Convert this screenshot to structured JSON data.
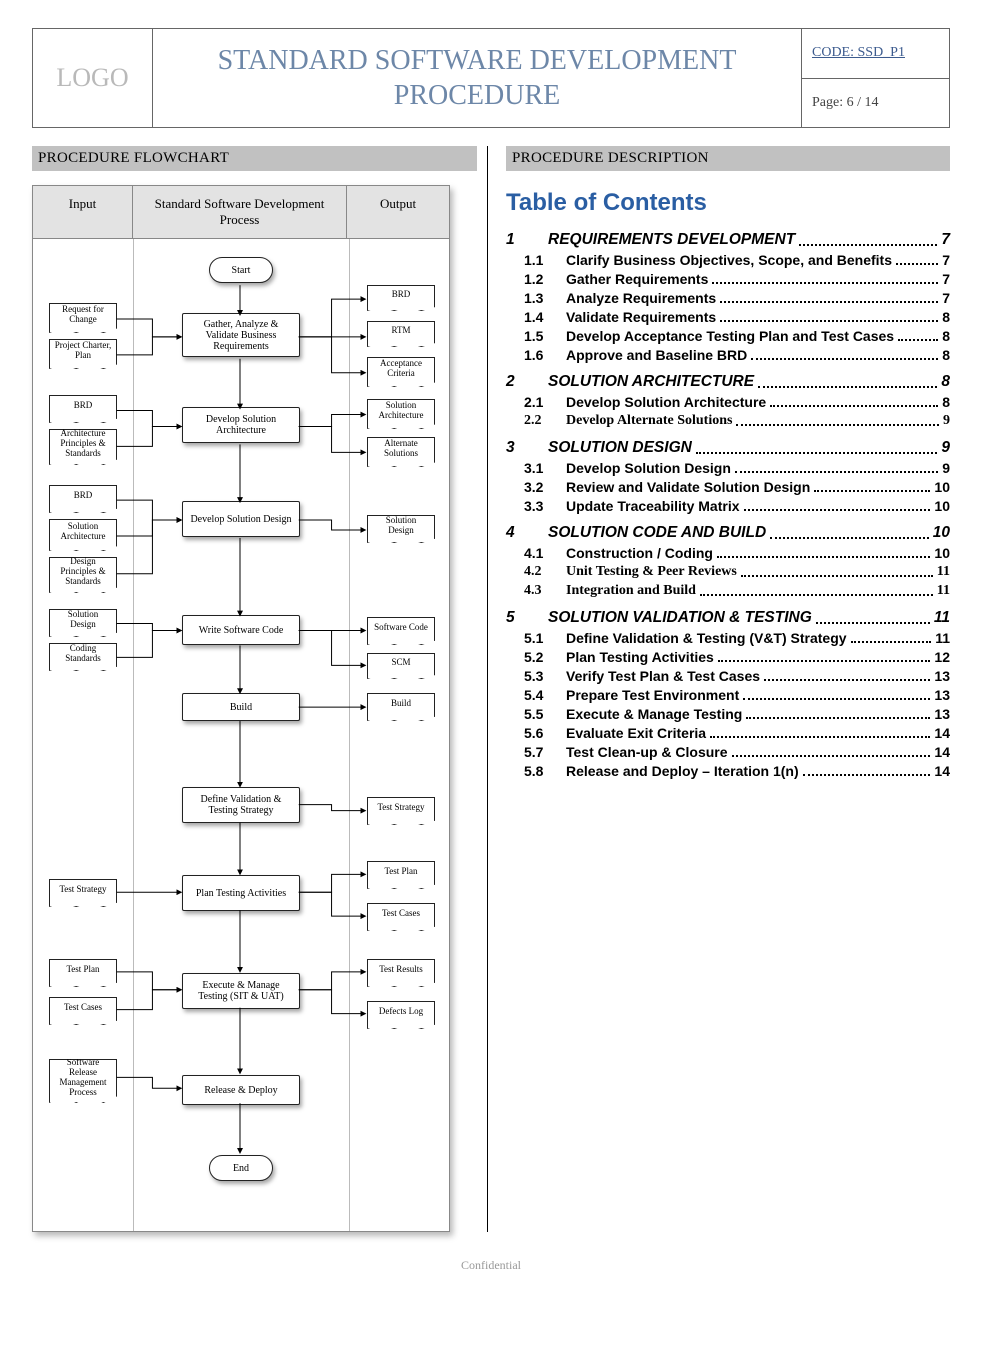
{
  "header": {
    "logo": "LOGO",
    "title": "STANDARD SOFTWARE DEVELOPMENT PROCEDURE",
    "code_label": "CODE:",
    "code_value": "SSD_P1",
    "page_label": "Page: 6 / 14"
  },
  "sections": {
    "flow": "PROCEDURE FLOWCHART",
    "desc": "PROCEDURE DESCRIPTION"
  },
  "flow": {
    "head_input": "Input",
    "head_process": "Standard Software Development Process",
    "head_output": "Output",
    "start": "Start",
    "end": "End",
    "procs": {
      "p1": "Gather, Analyze & Validate Business Requirements",
      "p2": "Develop Solution Architecture",
      "p3": "Develop Solution Design",
      "p4": "Write Software Code",
      "p5": "Build",
      "p6": "Define Validation & Testing Strategy",
      "p7": "Plan Testing Activities",
      "p8": "Execute & Manage Testing (SIT & UAT)",
      "p9": "Release & Deploy"
    },
    "inputs": {
      "i1": "Request for Change",
      "i2": "Project Charter, Plan",
      "i3": "BRD",
      "i4": "Architecture Principles & Standards",
      "i5": "BRD",
      "i6": "Solution Architecture",
      "i7": "Design Principles & Standards",
      "i8": "Solution Design",
      "i9": "Coding Standards",
      "i10": "Test Strategy",
      "i11": "Test Plan",
      "i12": "Test Cases",
      "i13": "Software Release Management Process"
    },
    "outputs": {
      "o1": "BRD",
      "o2": "RTM",
      "o3": "Acceptance Criteria",
      "o4": "Solution Architecture",
      "o5": "Alternate Solutions",
      "o6": "Solution Design",
      "o7": "Software Code",
      "o8": "SCM",
      "o9": "Build",
      "o10": "Test Strategy",
      "o11": "Test Plan",
      "o12": "Test Cases",
      "o13": "Test Results",
      "o14": "Defects Log"
    }
  },
  "toc": {
    "title": "Table of Contents",
    "rows": [
      {
        "lvl": 1,
        "num": "1",
        "label": "REQUIREMENTS DEVELOPMENT",
        "page": "7"
      },
      {
        "lvl": 2,
        "num": "1.1",
        "label": "Clarify Business Objectives, Scope, and Benefits",
        "page": "7"
      },
      {
        "lvl": 2,
        "num": "1.2",
        "label": "Gather Requirements",
        "page": "7"
      },
      {
        "lvl": 2,
        "num": "1.3",
        "label": "Analyze Requirements",
        "page": "7"
      },
      {
        "lvl": 2,
        "num": "1.4",
        "label": "Validate Requirements",
        "page": "8"
      },
      {
        "lvl": 2,
        "num": "1.5",
        "label": "Develop Acceptance Testing Plan and Test Cases",
        "page": "8"
      },
      {
        "lvl": 2,
        "num": "1.6",
        "label": "Approve and Baseline BRD",
        "page": "8"
      },
      {
        "lvl": 1,
        "num": "2",
        "label": "SOLUTION ARCHITECTURE",
        "page": "8"
      },
      {
        "lvl": 2,
        "num": "2.1",
        "label": "Develop Solution Architecture",
        "page": "8"
      },
      {
        "lvl": 2,
        "num": "2.2",
        "label": "Develop Alternate Solutions",
        "page": "9",
        "serif": true
      },
      {
        "lvl": 1,
        "num": "3",
        "label": "SOLUTION DESIGN",
        "page": "9"
      },
      {
        "lvl": 2,
        "num": "3.1",
        "label": "Develop Solution Design",
        "page": "9"
      },
      {
        "lvl": 2,
        "num": "3.2",
        "label": "Review and Validate Solution Design",
        "page": "10"
      },
      {
        "lvl": 2,
        "num": "3.3",
        "label": "Update Traceability Matrix",
        "page": "10"
      },
      {
        "lvl": 1,
        "num": "4",
        "label": "SOLUTION CODE AND BUILD",
        "page": "10"
      },
      {
        "lvl": 2,
        "num": "4.1",
        "label": "Construction / Coding",
        "page": "10"
      },
      {
        "lvl": 2,
        "num": "4.2",
        "label": "Unit Testing & Peer Reviews",
        "page": "11",
        "serif": true
      },
      {
        "lvl": 2,
        "num": "4.3",
        "label": "Integration and Build",
        "page": "11",
        "serif": true
      },
      {
        "lvl": 1,
        "num": "5",
        "label": "SOLUTION VALIDATION & TESTING",
        "page": "11"
      },
      {
        "lvl": 2,
        "num": "5.1",
        "label": "Define Validation & Testing (V&T) Strategy",
        "page": "11"
      },
      {
        "lvl": 2,
        "num": "5.2",
        "label": "Plan Testing Activities",
        "page": "12"
      },
      {
        "lvl": 2,
        "num": "5.3",
        "label": "Verify Test Plan & Test Cases",
        "page": "13"
      },
      {
        "lvl": 2,
        "num": "5.4",
        "label": "Prepare Test Environment",
        "page": "13"
      },
      {
        "lvl": 2,
        "num": "5.5",
        "label": "Execute & Manage Testing",
        "page": "13"
      },
      {
        "lvl": 2,
        "num": "5.6",
        "label": "Evaluate Exit Criteria",
        "page": "14"
      },
      {
        "lvl": 2,
        "num": "5.7",
        "label": "Test Clean-up & Closure",
        "page": "14"
      },
      {
        "lvl": 2,
        "num": "5.8",
        "label": "Release and Deploy – Iteration 1(n)",
        "page": "14"
      }
    ]
  },
  "footer": "Confidential"
}
